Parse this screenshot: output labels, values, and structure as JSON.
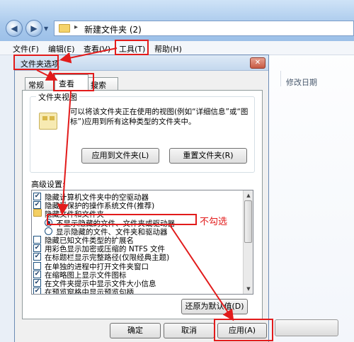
{
  "address": {
    "path": "新建文件夹 (2)"
  },
  "menu": [
    {
      "id": "file",
      "label": "文件(F)"
    },
    {
      "id": "edit",
      "label": "编辑(E)"
    },
    {
      "id": "view",
      "label": "查看(V)"
    },
    {
      "id": "tools",
      "label": "工具(T)"
    },
    {
      "id": "help",
      "label": "帮助(H)"
    }
  ],
  "explorer": {
    "column_modified": "修改日期"
  },
  "dialog": {
    "title": "文件夹选项",
    "close_glyph": "✕",
    "tabs": [
      "常规",
      "查看",
      "搜索"
    ],
    "active_tab": "查看",
    "folder_view": {
      "legend": "文件夹视图",
      "description": "可以将该文件夹正在使用的视图(例如“详细信息”或“图标”)应用到所有这种类型的文件夹中。",
      "apply_button": "应用到文件夹(L)",
      "reset_button": "重置文件夹(R)"
    },
    "advanced": {
      "label": "高级设置:",
      "items": [
        {
          "type": "checkbox",
          "checked": true,
          "label": "隐藏计算机文件夹中的空驱动器"
        },
        {
          "type": "checkbox",
          "checked": true,
          "label": "隐藏受保护的操作系统文件(推荐)"
        },
        {
          "type": "folder",
          "label": "隐藏文件和文件夹"
        },
        {
          "type": "radio",
          "checked": true,
          "label": "不显示隐藏的文件、文件夹或驱动器"
        },
        {
          "type": "radio",
          "checked": false,
          "label": "显示隐藏的文件、文件夹和驱动器"
        },
        {
          "type": "checkbox",
          "checked": false,
          "label": "隐藏已知文件类型的扩展名"
        },
        {
          "type": "checkbox",
          "checked": true,
          "label": "用彩色显示加密或压缩的 NTFS 文件"
        },
        {
          "type": "checkbox",
          "checked": true,
          "label": "在标题栏显示完整路径(仅限经典主题)"
        },
        {
          "type": "checkbox",
          "checked": false,
          "label": "在单独的进程中打开文件夹窗口"
        },
        {
          "type": "checkbox",
          "checked": true,
          "label": "在缩略图上显示文件图标"
        },
        {
          "type": "checkbox",
          "checked": true,
          "label": "在文件夹提示中显示文件大小信息"
        },
        {
          "type": "checkbox",
          "checked": true,
          "label": "在预览窗格中显示预览句柄"
        }
      ],
      "restore_button": "还原为默认值(D)"
    },
    "buttons": {
      "ok": "确定",
      "cancel": "取消",
      "apply": "应用(A)"
    }
  },
  "annotation": {
    "text": "不勾选",
    "color": "#e21b1b"
  },
  "colors": {
    "title_gradient_top": "#cfe3f7",
    "dialog_bg": "#f0f0f0",
    "highlight": "#e21b1b"
  }
}
